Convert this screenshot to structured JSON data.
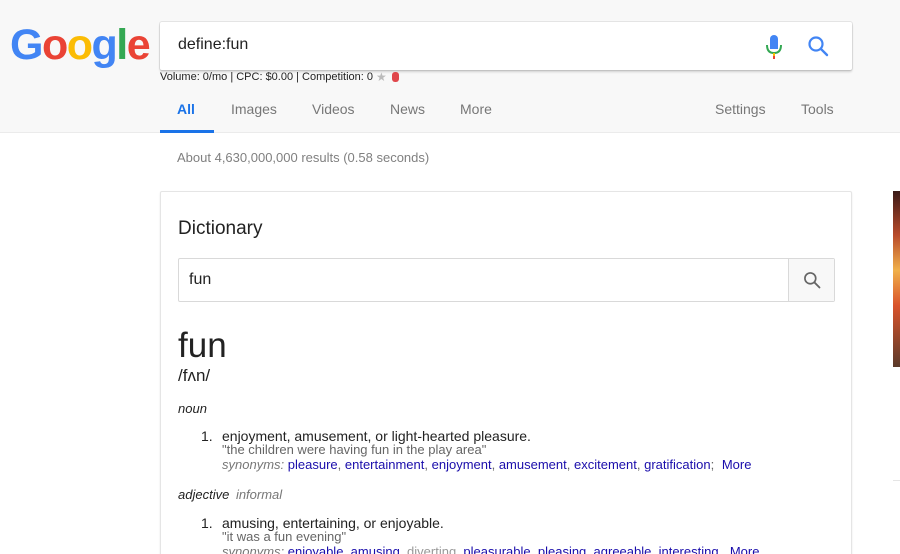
{
  "logo": {
    "letters": [
      "G",
      "o",
      "o",
      "g",
      "l",
      "e"
    ]
  },
  "search": {
    "query": "define:fun"
  },
  "seo": {
    "text": "Volume: 0/mo | CPC: $0.00 | Competition: 0"
  },
  "tabs": {
    "all": "All",
    "images": "Images",
    "videos": "Videos",
    "news": "News",
    "more": "More",
    "settings": "Settings",
    "tools": "Tools"
  },
  "stats": "About 4,630,000,000 results (0.58 seconds)",
  "dictionary": {
    "title": "Dictionary",
    "input_value": "fun",
    "word": "fun",
    "pronunciation": "/fʌn/",
    "noun": {
      "pos": "noun",
      "num": "1.",
      "definition": "enjoyment, amusement, or light-hearted pleasure.",
      "example": "\"the children were having fun in the play area\"",
      "synonyms_label": "synonyms:",
      "synonyms": [
        "pleasure",
        "entertainment",
        "enjoyment",
        "amusement",
        "excitement",
        "gratification"
      ],
      "more": "More"
    },
    "adjective": {
      "pos": "adjective",
      "register": "informal",
      "num": "1.",
      "definition": "amusing, entertaining, or enjoyable.",
      "example": "\"it was a fun evening\"",
      "synonyms_label": "synonyms:",
      "synonyms_linked": [
        "enjoyable",
        "amusing"
      ],
      "synonyms_plain": [
        "diverting"
      ],
      "synonyms_linked2": [
        "pleasurable",
        "pleasing",
        "agreeable",
        "interesting"
      ],
      "more": "More"
    }
  },
  "colors": {
    "g_blue": "#4285f4",
    "g_red": "#ea4335",
    "g_yellow": "#fbbc05",
    "g_green": "#34a853",
    "link": "#1a0dab",
    "tab_active": "#1a73e8"
  }
}
